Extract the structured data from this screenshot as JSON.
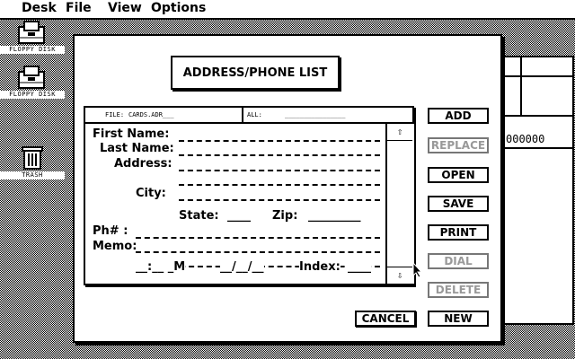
{
  "menu": [
    "Desk",
    "File",
    "View",
    "Options"
  ],
  "desktop_icons": [
    {
      "label": "FLOPPY DISK",
      "icon": "floppy-drawer-icon"
    },
    {
      "label": "FLOPPY DISK",
      "icon": "floppy-drawer-icon"
    },
    {
      "label": "TRASH",
      "icon": "trash-can-icon"
    }
  ],
  "background_window": {
    "text": "000000"
  },
  "dialog": {
    "title": "ADDRESS/PHONE LIST",
    "file_label": "FILE:",
    "file_value": "CARDS.ADR___",
    "all_label": "ALL:",
    "all_value": "________________",
    "fields": {
      "first_name": "First Name:",
      "last_name": "Last Name:",
      "address": "Address:",
      "city": "City:",
      "state": "State:",
      "state_value": "____",
      "zip": "Zip:",
      "zip_value": "_________",
      "phone": "Ph# :",
      "memo": "Memo:",
      "time": "__:__ _M",
      "date": "__/__/__",
      "index": "Index:",
      "index_value": "____"
    },
    "scroll": {
      "up": "⇧",
      "down": "⇩"
    },
    "buttons": {
      "add": "ADD",
      "replace": "REPLACE",
      "open": "OPEN",
      "save": "SAVE",
      "print": "PRINT",
      "dial": "DIAL",
      "delete": "DELETE",
      "cancel": "CANCEL",
      "new": "NEW"
    }
  }
}
